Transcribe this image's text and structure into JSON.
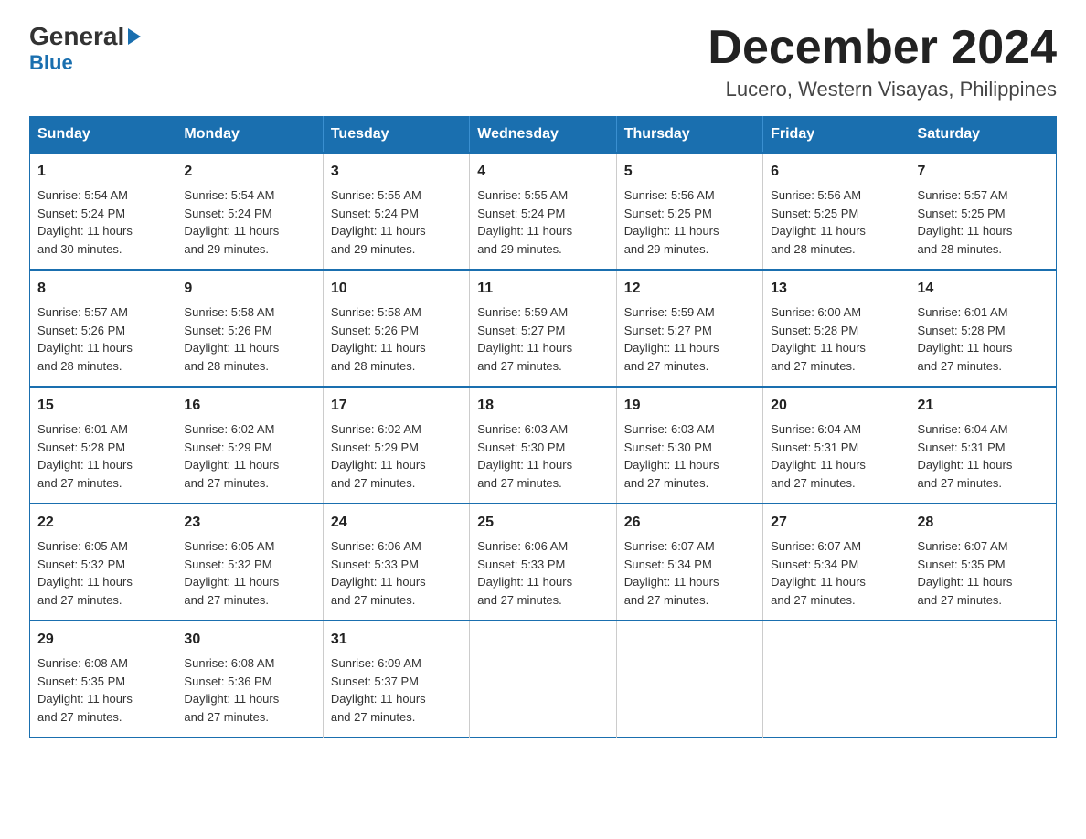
{
  "logo": {
    "general": "General",
    "arrow": "▶",
    "blue": "Blue"
  },
  "title": "December 2024",
  "subtitle": "Lucero, Western Visayas, Philippines",
  "weekdays": [
    "Sunday",
    "Monday",
    "Tuesday",
    "Wednesday",
    "Thursday",
    "Friday",
    "Saturday"
  ],
  "weeks": [
    [
      {
        "day": "1",
        "info": "Sunrise: 5:54 AM\nSunset: 5:24 PM\nDaylight: 11 hours\nand 30 minutes."
      },
      {
        "day": "2",
        "info": "Sunrise: 5:54 AM\nSunset: 5:24 PM\nDaylight: 11 hours\nand 29 minutes."
      },
      {
        "day": "3",
        "info": "Sunrise: 5:55 AM\nSunset: 5:24 PM\nDaylight: 11 hours\nand 29 minutes."
      },
      {
        "day": "4",
        "info": "Sunrise: 5:55 AM\nSunset: 5:24 PM\nDaylight: 11 hours\nand 29 minutes."
      },
      {
        "day": "5",
        "info": "Sunrise: 5:56 AM\nSunset: 5:25 PM\nDaylight: 11 hours\nand 29 minutes."
      },
      {
        "day": "6",
        "info": "Sunrise: 5:56 AM\nSunset: 5:25 PM\nDaylight: 11 hours\nand 28 minutes."
      },
      {
        "day": "7",
        "info": "Sunrise: 5:57 AM\nSunset: 5:25 PM\nDaylight: 11 hours\nand 28 minutes."
      }
    ],
    [
      {
        "day": "8",
        "info": "Sunrise: 5:57 AM\nSunset: 5:26 PM\nDaylight: 11 hours\nand 28 minutes."
      },
      {
        "day": "9",
        "info": "Sunrise: 5:58 AM\nSunset: 5:26 PM\nDaylight: 11 hours\nand 28 minutes."
      },
      {
        "day": "10",
        "info": "Sunrise: 5:58 AM\nSunset: 5:26 PM\nDaylight: 11 hours\nand 28 minutes."
      },
      {
        "day": "11",
        "info": "Sunrise: 5:59 AM\nSunset: 5:27 PM\nDaylight: 11 hours\nand 27 minutes."
      },
      {
        "day": "12",
        "info": "Sunrise: 5:59 AM\nSunset: 5:27 PM\nDaylight: 11 hours\nand 27 minutes."
      },
      {
        "day": "13",
        "info": "Sunrise: 6:00 AM\nSunset: 5:28 PM\nDaylight: 11 hours\nand 27 minutes."
      },
      {
        "day": "14",
        "info": "Sunrise: 6:01 AM\nSunset: 5:28 PM\nDaylight: 11 hours\nand 27 minutes."
      }
    ],
    [
      {
        "day": "15",
        "info": "Sunrise: 6:01 AM\nSunset: 5:28 PM\nDaylight: 11 hours\nand 27 minutes."
      },
      {
        "day": "16",
        "info": "Sunrise: 6:02 AM\nSunset: 5:29 PM\nDaylight: 11 hours\nand 27 minutes."
      },
      {
        "day": "17",
        "info": "Sunrise: 6:02 AM\nSunset: 5:29 PM\nDaylight: 11 hours\nand 27 minutes."
      },
      {
        "day": "18",
        "info": "Sunrise: 6:03 AM\nSunset: 5:30 PM\nDaylight: 11 hours\nand 27 minutes."
      },
      {
        "day": "19",
        "info": "Sunrise: 6:03 AM\nSunset: 5:30 PM\nDaylight: 11 hours\nand 27 minutes."
      },
      {
        "day": "20",
        "info": "Sunrise: 6:04 AM\nSunset: 5:31 PM\nDaylight: 11 hours\nand 27 minutes."
      },
      {
        "day": "21",
        "info": "Sunrise: 6:04 AM\nSunset: 5:31 PM\nDaylight: 11 hours\nand 27 minutes."
      }
    ],
    [
      {
        "day": "22",
        "info": "Sunrise: 6:05 AM\nSunset: 5:32 PM\nDaylight: 11 hours\nand 27 minutes."
      },
      {
        "day": "23",
        "info": "Sunrise: 6:05 AM\nSunset: 5:32 PM\nDaylight: 11 hours\nand 27 minutes."
      },
      {
        "day": "24",
        "info": "Sunrise: 6:06 AM\nSunset: 5:33 PM\nDaylight: 11 hours\nand 27 minutes."
      },
      {
        "day": "25",
        "info": "Sunrise: 6:06 AM\nSunset: 5:33 PM\nDaylight: 11 hours\nand 27 minutes."
      },
      {
        "day": "26",
        "info": "Sunrise: 6:07 AM\nSunset: 5:34 PM\nDaylight: 11 hours\nand 27 minutes."
      },
      {
        "day": "27",
        "info": "Sunrise: 6:07 AM\nSunset: 5:34 PM\nDaylight: 11 hours\nand 27 minutes."
      },
      {
        "day": "28",
        "info": "Sunrise: 6:07 AM\nSunset: 5:35 PM\nDaylight: 11 hours\nand 27 minutes."
      }
    ],
    [
      {
        "day": "29",
        "info": "Sunrise: 6:08 AM\nSunset: 5:35 PM\nDaylight: 11 hours\nand 27 minutes."
      },
      {
        "day": "30",
        "info": "Sunrise: 6:08 AM\nSunset: 5:36 PM\nDaylight: 11 hours\nand 27 minutes."
      },
      {
        "day": "31",
        "info": "Sunrise: 6:09 AM\nSunset: 5:37 PM\nDaylight: 11 hours\nand 27 minutes."
      },
      null,
      null,
      null,
      null
    ]
  ]
}
